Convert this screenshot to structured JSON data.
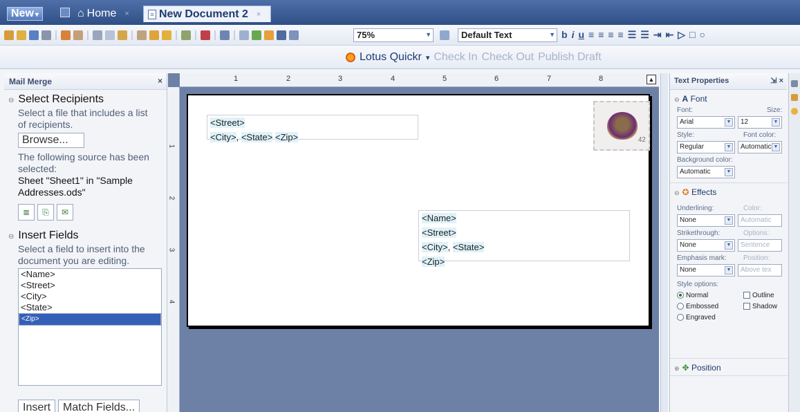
{
  "top_tabs": {
    "new_label": "New",
    "home_label": "Home",
    "doc_label": "New Document 2",
    "close_glyph": "×"
  },
  "toolbar": {
    "zoom_value": "75%",
    "style_value": "Default Text",
    "bold_label": "b",
    "italic_label": "i",
    "underline_label": "u",
    "quickr_label": "Lotus Quickr",
    "quickr_caret": "▾",
    "checkin_label": "Check In",
    "checkout_label": "Check Out",
    "publish_label": "Publish Draft"
  },
  "mail_merge": {
    "title": "Mail Merge",
    "close": "×",
    "select_recipients": {
      "heading": "Select Recipients",
      "desc": "Select a file that includes a list of recipients.",
      "browse_label": "Browse...",
      "selected_desc": "The following source has been selected:",
      "source": "Sheet \"Sheet1\" in \"Sample Addresses.ods\""
    },
    "insert_fields": {
      "heading": "Insert Fields",
      "desc": "Select a field to insert into the document you are editing.",
      "fields": [
        "<Name>",
        "<Street>",
        "<City>",
        "<State>",
        "<Zip>"
      ],
      "insert_label": "Insert",
      "match_label": "Match Fields..."
    }
  },
  "document": {
    "ruler_numbers": [
      "1",
      "2",
      "3",
      "4",
      "5",
      "6",
      "7",
      "8"
    ],
    "vruler_numbers": [
      "1",
      "2",
      "3",
      "4"
    ],
    "return_address": {
      "street": "<Street>",
      "city": "<City>",
      "comma": ", ",
      "state": "<State>",
      "zip": "<Zip>"
    },
    "recipient_address": {
      "name": "<Name>",
      "street": "<Street>",
      "city": "<City>",
      "comma": ", ",
      "state": "<State>",
      "zip": "<Zip>"
    },
    "stamp_text": "42"
  },
  "text_properties": {
    "title": "Text Properties",
    "font_section": "Font",
    "font_label": "Font:",
    "size_label": "Size:",
    "font_value": "Arial",
    "size_value": "12",
    "style_label": "Style:",
    "font_color_label": "Font color:",
    "style_value": "Regular",
    "font_color_value": "Automatic",
    "bg_color_label": "Background color:",
    "bg_color_value": "Automatic",
    "effects_section": "Effects",
    "underlining_label": "Underlining:",
    "color_label": "Color:",
    "underlining_value": "None",
    "underline_color_value": "Automatic",
    "strikethrough_label": "Strikethrough:",
    "options_label": "Options:",
    "strikethrough_value": "None",
    "strike_options_value": "Sentence",
    "emphasis_label": "Emphasis mark:",
    "position_label": "Position:",
    "emphasis_value": "None",
    "emphasis_position_value": "Above tex",
    "style_options_label": "Style options:",
    "opt_normal": "Normal",
    "opt_embossed": "Embossed",
    "opt_engraved": "Engraved",
    "opt_outline": "Outline",
    "opt_shadow": "Shadow",
    "position_section": "Position"
  }
}
